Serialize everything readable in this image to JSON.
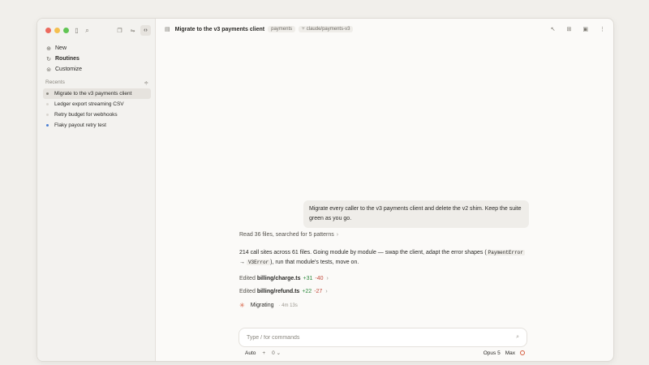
{
  "colors": {
    "accent": "#d55c3e",
    "add": "#2f8a3e",
    "del": "#c24b3c"
  },
  "sidebar": {
    "toolbar": {
      "sidebar_icon": "sidebar-toggle-icon",
      "search_icon": "search-icon",
      "seg": [
        "copy-icon",
        "split-icon",
        "code-icon"
      ]
    },
    "nav": [
      {
        "label": "New",
        "icon": "plus-icon"
      },
      {
        "label": "Routines",
        "icon": "routine-icon"
      },
      {
        "label": "Customize",
        "icon": "customize-icon"
      }
    ],
    "recents_label": "Recents",
    "recents": [
      {
        "label": "Migrate to the v3 payments client",
        "dot": "#8a877f",
        "selected": true
      },
      {
        "label": "Ledger export streaming CSV",
        "dot": "#d9d6d0",
        "selected": false
      },
      {
        "label": "Retry budget for webhooks",
        "dot": "#d9d6d0",
        "selected": false
      },
      {
        "label": "Flaky payout retry test",
        "dot": "#4a7fd4",
        "selected": false
      }
    ]
  },
  "header": {
    "title": "Migrate to the v3 payments client",
    "repo": "payments",
    "branch": "claude/payments-v3"
  },
  "conversation": {
    "user_message": "Migrate every caller to the v3 payments client and delete the v2 shim. Keep the suite green as you go.",
    "summary": "Read 36 files, searched for 5 patterns",
    "assistant_text_1": "214 call sites across 61 files. Going module by module — swap the client, adapt the error shapes (",
    "code_1": "PaymentError",
    "arrow": " → ",
    "code_2": "V3Error",
    "assistant_text_2": "), run that module's tests, move on.",
    "edits": [
      {
        "prefix": "Edited",
        "file": "billing/charge.ts",
        "add": "+31",
        "del": "-40"
      },
      {
        "prefix": "Edited",
        "file": "billing/refund.ts",
        "add": "+22",
        "del": "-27"
      }
    ],
    "status_label": "Migrating",
    "status_meta": "· 4m 13s"
  },
  "composer": {
    "placeholder": "Type / for commands",
    "mode": "Auto",
    "plus": "+",
    "count": "0",
    "model": "Opus 5",
    "effort": "Max"
  }
}
